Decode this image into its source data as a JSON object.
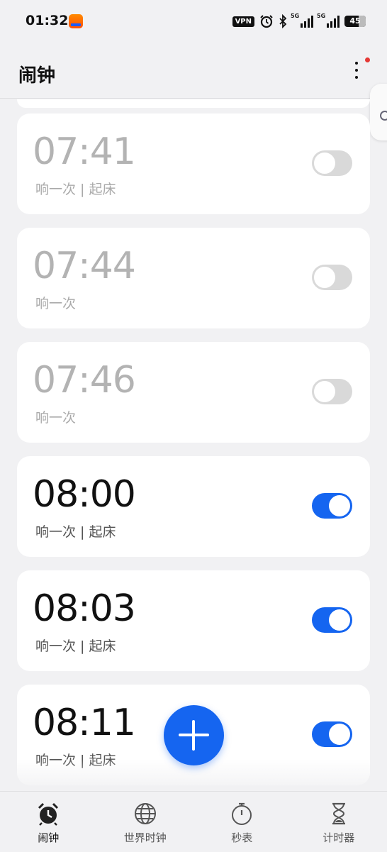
{
  "status_bar": {
    "time": "01:32",
    "vpn": "VPN",
    "network1": "5G",
    "network2": "5G",
    "battery": "45"
  },
  "header": {
    "title": "闹钟"
  },
  "alarms": [
    {
      "time": "07:41",
      "desc": "响一次 | 起床",
      "enabled": false
    },
    {
      "time": "07:44",
      "desc": "响一次",
      "enabled": false
    },
    {
      "time": "07:46",
      "desc": "响一次",
      "enabled": false
    },
    {
      "time": "08:00",
      "desc": "响一次 | 起床",
      "enabled": true
    },
    {
      "time": "08:03",
      "desc": "响一次 | 起床",
      "enabled": true
    },
    {
      "time": "08:11",
      "desc": "响一次 | 起床",
      "enabled": true
    }
  ],
  "nav": [
    {
      "label": "闹钟",
      "icon": "alarm-clock-icon",
      "active": true
    },
    {
      "label": "世界时钟",
      "icon": "globe-icon",
      "active": false
    },
    {
      "label": "秒表",
      "icon": "stopwatch-icon",
      "active": false
    },
    {
      "label": "计时器",
      "icon": "hourglass-icon",
      "active": false
    }
  ],
  "colors": {
    "accent": "#1565f0",
    "background": "#f1f1f3",
    "notification_dot": "#e53935"
  }
}
